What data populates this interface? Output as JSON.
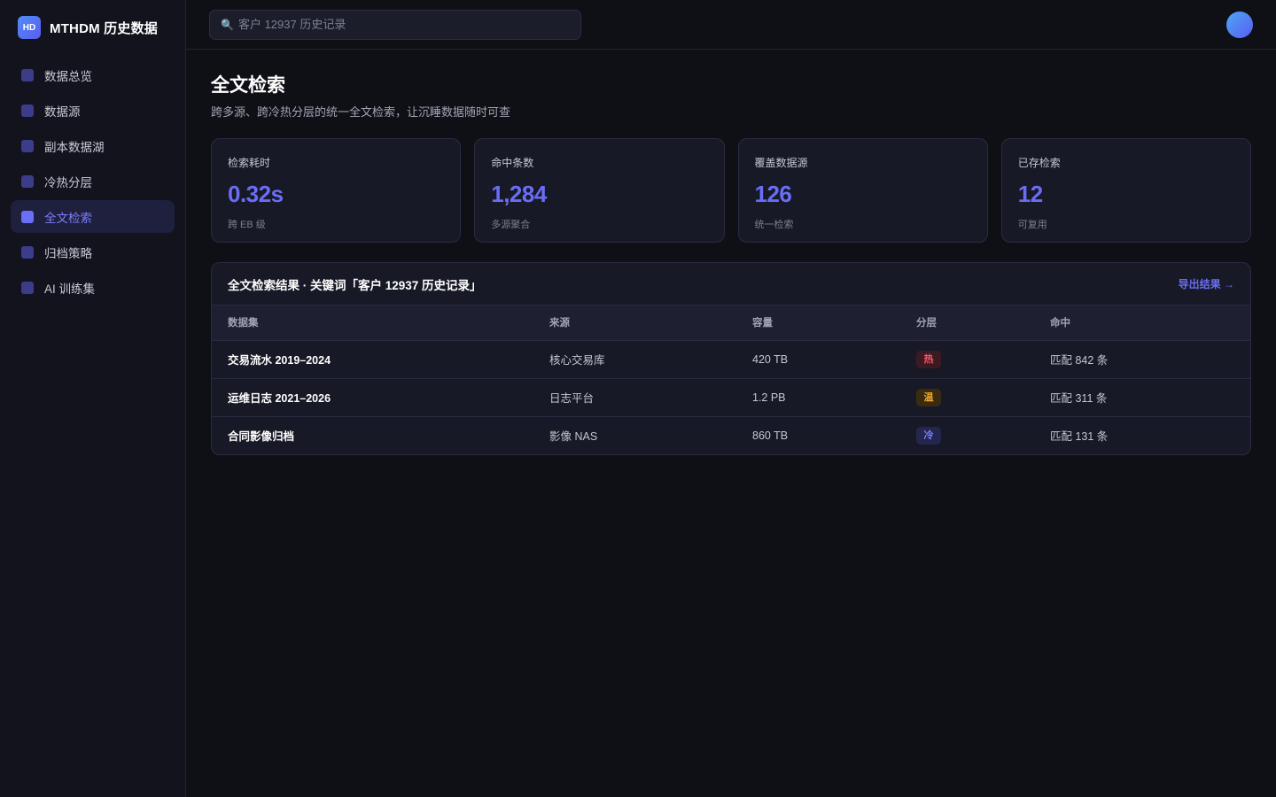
{
  "brand": {
    "logo_text": "HD",
    "name": "MTHDM 历史数据"
  },
  "sidebar": {
    "items": [
      {
        "label": "数据总览",
        "active": false
      },
      {
        "label": "数据源",
        "active": false
      },
      {
        "label": "副本数据湖",
        "active": false
      },
      {
        "label": "冷热分层",
        "active": false
      },
      {
        "label": "全文检索",
        "active": true
      },
      {
        "label": "归档策略",
        "active": false
      },
      {
        "label": "AI 训练集",
        "active": false
      }
    ]
  },
  "search": {
    "placeholder": "客户 12937 历史记录",
    "icon": "search-icon"
  },
  "page": {
    "title": "全文检索",
    "subtitle": "跨多源、跨冷热分层的统一全文检索，让沉睡数据随时可查"
  },
  "stats": [
    {
      "label": "检索耗时",
      "value": "0.32s",
      "sub": "跨 EB 级"
    },
    {
      "label": "命中条数",
      "value": "1,284",
      "sub": "多源聚合"
    },
    {
      "label": "覆盖数据源",
      "value": "126",
      "sub": "统一检索"
    },
    {
      "label": "已存检索",
      "value": "12",
      "sub": "可复用"
    }
  ],
  "results": {
    "title": "全文检索结果 · 关键词「客户 12937 历史记录」",
    "export_label": "导出结果 →",
    "columns": [
      "数据集",
      "来源",
      "容量",
      "分层",
      "命中"
    ],
    "rows": [
      {
        "dataset": "交易流水 2019–2024",
        "source": "核心交易库",
        "size": "420 TB",
        "tier": "热",
        "tier_class": "hot",
        "hits": "匹配 842 条"
      },
      {
        "dataset": "运维日志 2021–2026",
        "source": "日志平台",
        "size": "1.2 PB",
        "tier": "温",
        "tier_class": "warm",
        "hits": "匹配 311 条"
      },
      {
        "dataset": "合同影像归档",
        "source": "影像 NAS",
        "size": "860 TB",
        "tier": "冷",
        "tier_class": "cold",
        "hits": "匹配 131 条"
      }
    ]
  },
  "colors": {
    "accent": "#6a6df5",
    "hot": "#f4576a",
    "warm": "#f0a62e",
    "cold": "#7c7ffb"
  }
}
